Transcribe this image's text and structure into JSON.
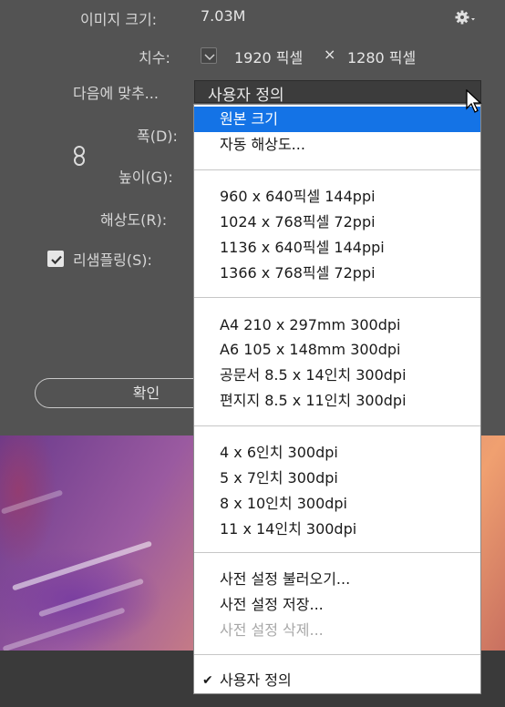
{
  "dialog": {
    "image_size_label": "이미지 크기:",
    "image_size_value": "7.03M",
    "dimensions_label": "치수:",
    "width_px": "1920 픽셀",
    "times": "×",
    "height_px": "1280 픽셀",
    "fit_to_label": "다음에 맞추...",
    "fit_to_value": "사용자 정의",
    "width_label": "폭(D):",
    "height_label": "높이(G):",
    "resolution_label": "해상도(R):",
    "resample_label": "리샘플링(S):",
    "resample_checked": true,
    "ok_label": "확인"
  },
  "menu": {
    "group1": [
      "원본 크기",
      "자동 해상도..."
    ],
    "group2": [
      "960 x 640픽셀 144ppi",
      "1024 x 768픽셀 72ppi",
      "1136 x 640픽셀 144ppi",
      "1366 x 768픽셀 72ppi"
    ],
    "group3": [
      "A4 210 x 297mm 300dpi",
      "A6 105 x 148mm 300dpi",
      "공문서 8.5 x 14인치 300dpi",
      "편지지 8.5 x 11인치 300dpi"
    ],
    "group4": [
      "4 x 6인치 300dpi",
      "5 x 7인치 300dpi",
      "8 x 10인치 300dpi",
      "11 x 14인치 300dpi"
    ],
    "group5": [
      "사전 설정 불러오기...",
      "사전 설정 저장...",
      "사전 설정 삭제..."
    ],
    "group6": [
      "사용자 정의"
    ],
    "selected_item": "원본 크기",
    "checked_item": "사용자 정의",
    "disabled_item": "사전 설정 삭제..."
  },
  "colors": {
    "highlight": "#1473e6",
    "dialog_bg": "#535353",
    "menu_bg": "#ffffff"
  }
}
